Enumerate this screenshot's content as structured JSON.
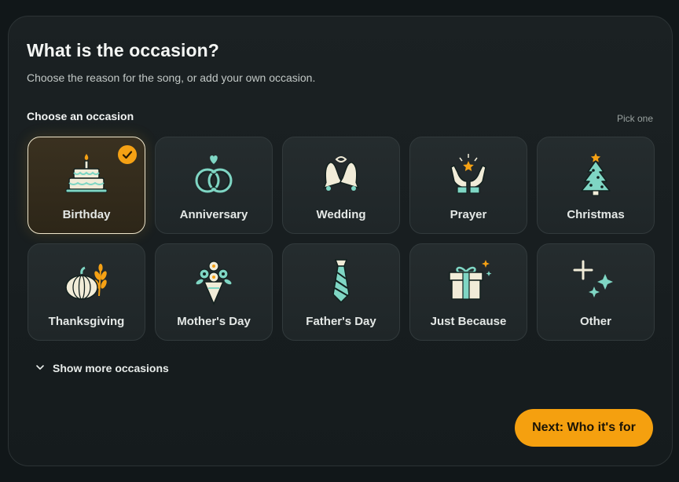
{
  "header": {
    "title": "What is the occasion?",
    "subtitle": "Choose the reason for the song, or add your own occasion."
  },
  "section": {
    "label": "Choose an occasion",
    "hint": "Pick one"
  },
  "occasions": [
    {
      "label": "Birthday",
      "icon": "cake-icon",
      "selected": true
    },
    {
      "label": "Anniversary",
      "icon": "rings-icon",
      "selected": false
    },
    {
      "label": "Wedding",
      "icon": "bells-icon",
      "selected": false
    },
    {
      "label": "Prayer",
      "icon": "praying-hands-icon",
      "selected": false
    },
    {
      "label": "Christmas",
      "icon": "christmas-tree-icon",
      "selected": false
    },
    {
      "label": "Thanksgiving",
      "icon": "pumpkin-icon",
      "selected": false
    },
    {
      "label": "Mother's Day",
      "icon": "bouquet-icon",
      "selected": false
    },
    {
      "label": "Father's Day",
      "icon": "necktie-icon",
      "selected": false
    },
    {
      "label": "Just Because",
      "icon": "gift-icon",
      "selected": false
    },
    {
      "label": "Other",
      "icon": "sparkles-icon",
      "selected": false
    }
  ],
  "more": {
    "label": "Show more occasions",
    "icon": "chevron-down-icon"
  },
  "next_button": {
    "label": "Next: Who it's for"
  },
  "colors": {
    "accent": "#f5a00f",
    "icon_primary": "#f1ecd8",
    "icon_secondary": "#7fd6c4",
    "icon_outline": "#12201e"
  }
}
